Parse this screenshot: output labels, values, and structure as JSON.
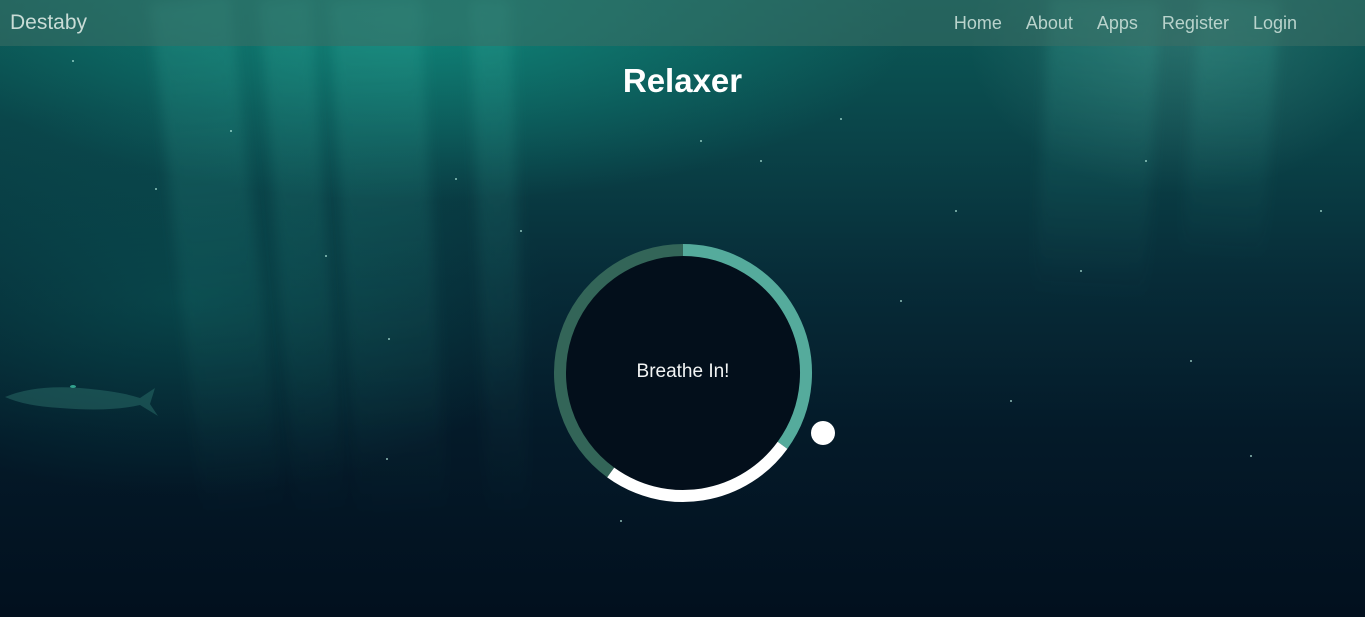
{
  "navbar": {
    "brand": "Destaby",
    "links": [
      {
        "label": "Home"
      },
      {
        "label": "About"
      },
      {
        "label": "Apps"
      },
      {
        "label": "Register"
      },
      {
        "label": "Login"
      }
    ]
  },
  "main": {
    "title": "Relaxer",
    "breathe_text": "Breathe In!"
  },
  "colors": {
    "navbar_bg": "#3c6e64",
    "ring_hold": "#336558",
    "ring_in": "#55ab9c",
    "ring_out": "#ffffff",
    "circle_fill": "#030f1b",
    "text_primary": "#ffffff",
    "nav_text": "#b9d3cc"
  }
}
